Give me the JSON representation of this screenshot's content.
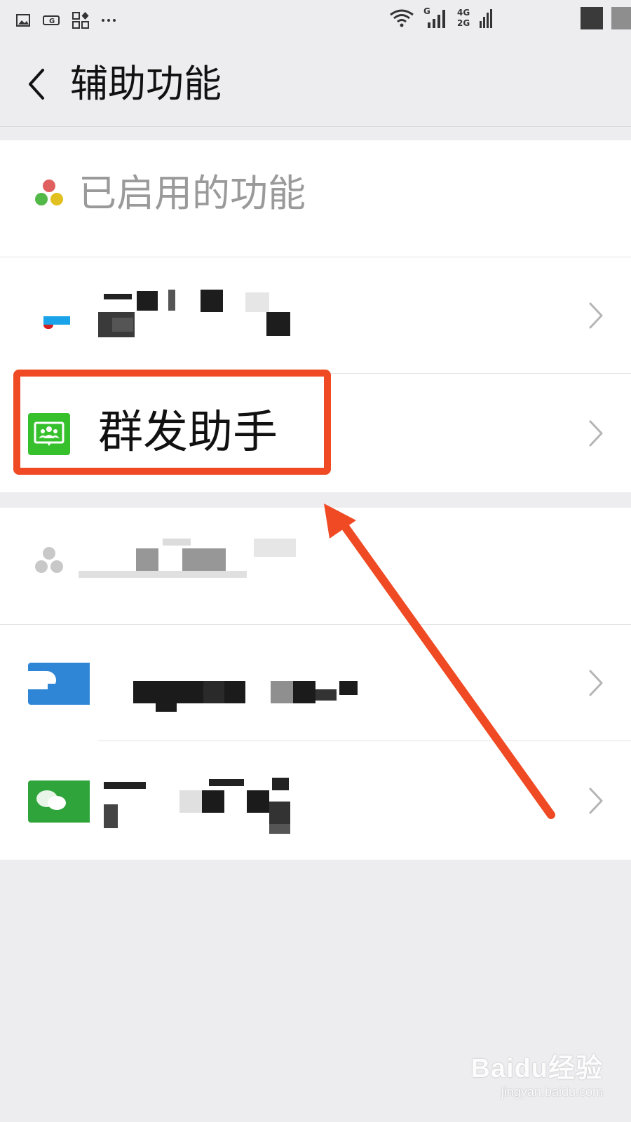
{
  "status_bar": {
    "network_top": "4G",
    "network_bottom": "2G",
    "sim_label": "G"
  },
  "header": {
    "title": "辅助功能"
  },
  "enabled_section": {
    "title": "已启用的功能",
    "items": [
      {
        "label": "",
        "redacted": true,
        "icon": "app-icon-blue-red"
      },
      {
        "label": "群发助手",
        "redacted": false,
        "icon": "mass-message-icon"
      }
    ]
  },
  "disabled_section": {
    "title": "",
    "redacted": true,
    "items": [
      {
        "label": "",
        "redacted": true,
        "icon": "app-icon-blue"
      },
      {
        "label": "",
        "redacted": true,
        "icon": "app-icon-green"
      }
    ]
  },
  "watermark": {
    "logo": "Baidu经验",
    "url": "jingyan.baidu.com"
  },
  "colors": {
    "annotation": "#ef4a23",
    "wechat_green": "#2dc100",
    "background": "#ededf0"
  }
}
